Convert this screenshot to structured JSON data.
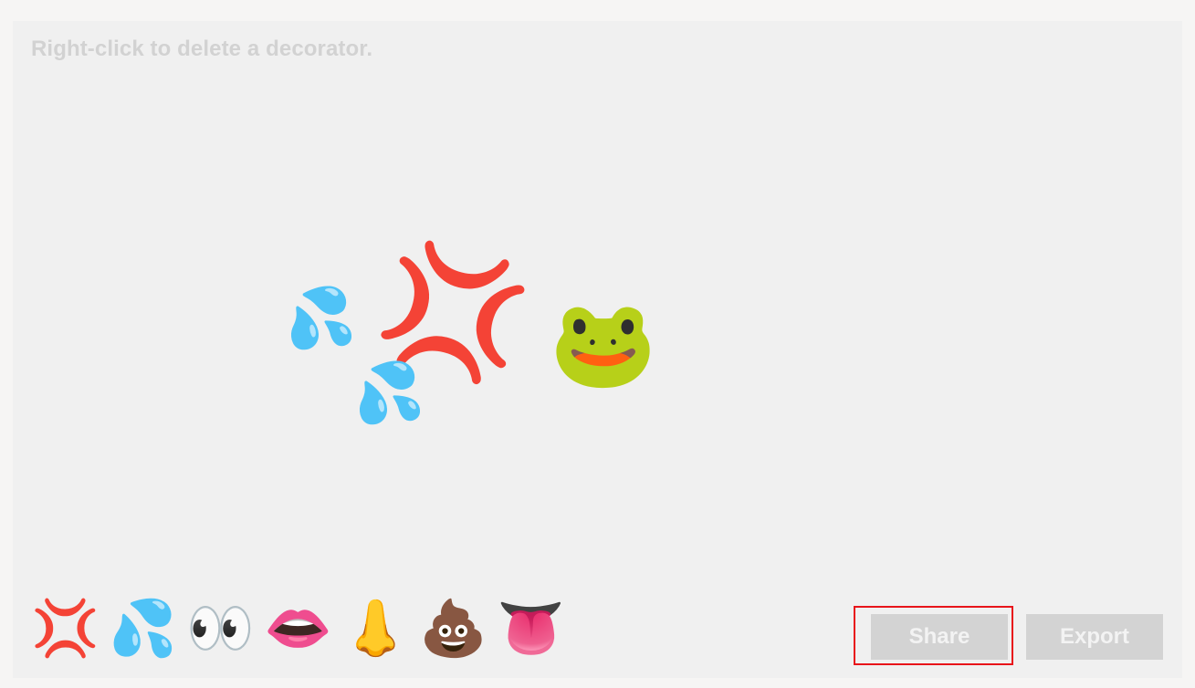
{
  "hint": "Right-click to delete a decorator.",
  "placed_decorators": [
    {
      "name": "sweat-droplets-icon",
      "glyph": "💦"
    },
    {
      "name": "anger-symbol-icon",
      "glyph": "💢"
    },
    {
      "name": "sweat-droplets-icon",
      "glyph": "💦"
    },
    {
      "name": "frog-face-icon",
      "glyph": "🐸"
    }
  ],
  "palette": [
    {
      "name": "anger-symbol-icon",
      "glyph": "💢"
    },
    {
      "name": "sweat-droplets-icon",
      "glyph": "💦"
    },
    {
      "name": "eyes-icon",
      "glyph": "👀"
    },
    {
      "name": "mouth-icon",
      "glyph": "👄"
    },
    {
      "name": "nose-icon",
      "glyph": "👃"
    },
    {
      "name": "pile-of-poo-icon",
      "glyph": "💩"
    },
    {
      "name": "tongue-icon",
      "glyph": "👅"
    }
  ],
  "buttons": {
    "share": "Share",
    "export": "Export"
  },
  "colors": {
    "highlight": "#e8141a",
    "button_bg": "#d3d3d3"
  }
}
